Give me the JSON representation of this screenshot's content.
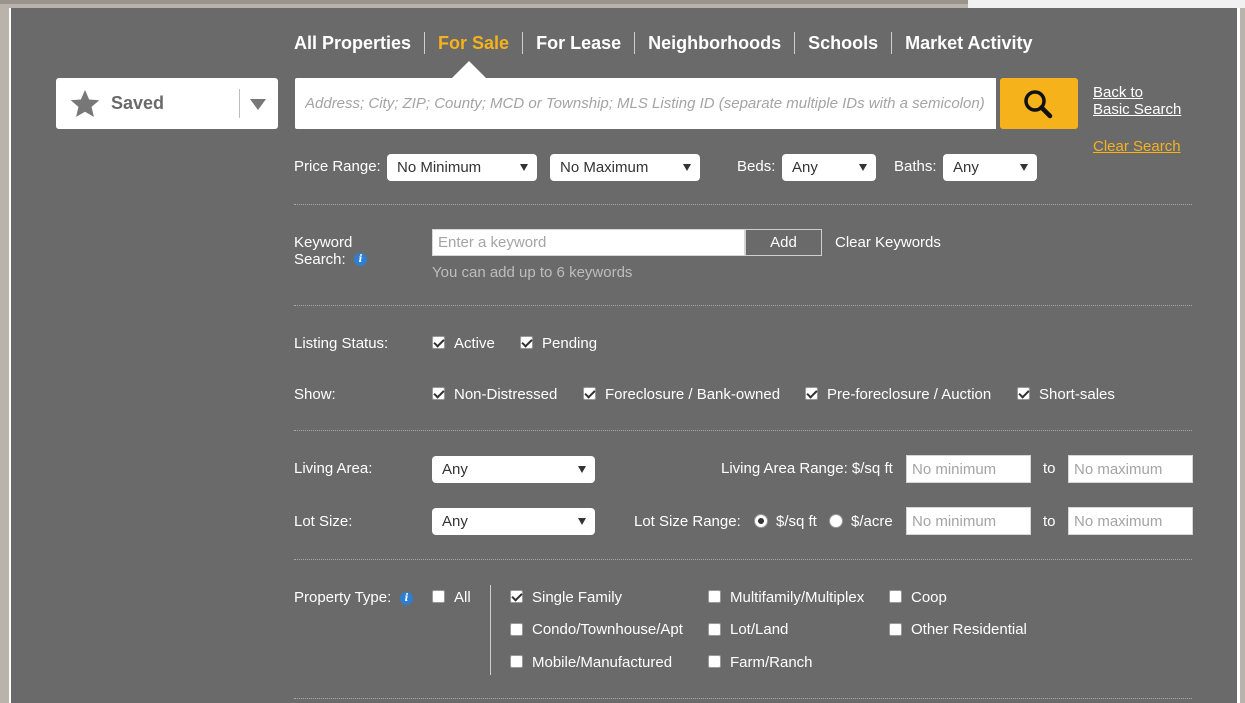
{
  "nav": {
    "tabs": [
      {
        "label": "All Properties",
        "active": false
      },
      {
        "label": "For Sale",
        "active": true
      },
      {
        "label": "For Lease",
        "active": false
      },
      {
        "label": "Neighborhoods",
        "active": false
      },
      {
        "label": "Schools",
        "active": false
      },
      {
        "label": "Market Activity",
        "active": false
      }
    ]
  },
  "saved": {
    "label": "Saved",
    "icon": "star-icon"
  },
  "search": {
    "placeholder": "Address; City; ZIP; County; MCD or Township; MLS Listing ID (separate multiple IDs with a semicolon)",
    "button_icon": "search-icon"
  },
  "links": {
    "back_line1": "Back to",
    "back_line2": "Basic Search",
    "clear_search": "Clear Search"
  },
  "price": {
    "label": "Price Range:",
    "min": "No Minimum",
    "max": "No Maximum",
    "beds_label": "Beds:",
    "beds": "Any",
    "baths_label": "Baths:",
    "baths": "Any"
  },
  "keyword": {
    "label_line1": "Keyword",
    "label_line2": "Search:",
    "placeholder": "Enter a keyword",
    "add": "Add",
    "clear": "Clear Keywords",
    "hint": "You can add up to 6 keywords"
  },
  "status": {
    "label": "Listing Status:",
    "options": [
      {
        "label": "Active",
        "checked": true
      },
      {
        "label": "Pending",
        "checked": true
      }
    ]
  },
  "show": {
    "label": "Show:",
    "options": [
      {
        "label": "Non-Distressed",
        "checked": true
      },
      {
        "label": "Foreclosure / Bank-owned",
        "checked": true
      },
      {
        "label": "Pre-foreclosure / Auction",
        "checked": true
      },
      {
        "label": "Short-sales",
        "checked": true
      }
    ]
  },
  "living": {
    "label": "Living Area:",
    "value": "Any",
    "range_label": "Living Area Range: $/sq ft",
    "min_placeholder": "No minimum",
    "to": "to",
    "max_placeholder": "No maximum"
  },
  "lot": {
    "label": "Lot Size:",
    "value": "Any",
    "range_label": "Lot Size Range:",
    "unit_sqft": "$/sq ft",
    "unit_acre": "$/acre",
    "selected_unit": "$/sq ft",
    "min_placeholder": "No minimum",
    "to": "to",
    "max_placeholder": "No maximum"
  },
  "property_type": {
    "label": "Property Type:",
    "all": {
      "label": "All",
      "checked": false
    },
    "options": [
      {
        "label": "Single Family",
        "checked": true
      },
      {
        "label": "Multifamily/Multiplex",
        "checked": false
      },
      {
        "label": "Coop",
        "checked": false
      },
      {
        "label": "Condo/Townhouse/Apt",
        "checked": false
      },
      {
        "label": "Lot/Land",
        "checked": false
      },
      {
        "label": "Other Residential",
        "checked": false
      },
      {
        "label": "Mobile/Manufactured",
        "checked": false
      },
      {
        "label": "Farm/Ranch",
        "checked": false
      }
    ]
  },
  "colors": {
    "accent": "#f5b21b",
    "panel": "#6a6a6a"
  }
}
